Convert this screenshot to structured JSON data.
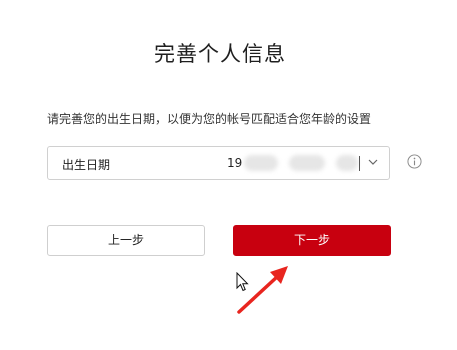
{
  "title": "完善个人信息",
  "description": "请完善您的出生日期，以便为您的帐号匹配适合您年龄的设置",
  "dob": {
    "label": "出生日期",
    "year_prefix": "19"
  },
  "buttons": {
    "prev_label": "上一步",
    "next_label": "下一步"
  },
  "colors": {
    "primary": "#c8000f",
    "annotation_arrow": "#e8251f"
  },
  "icons": {
    "info": "info-icon",
    "chevron": "chevron-down-icon",
    "cursor": "mouse-pointer-icon",
    "annotation": "red-arrow-icon"
  }
}
